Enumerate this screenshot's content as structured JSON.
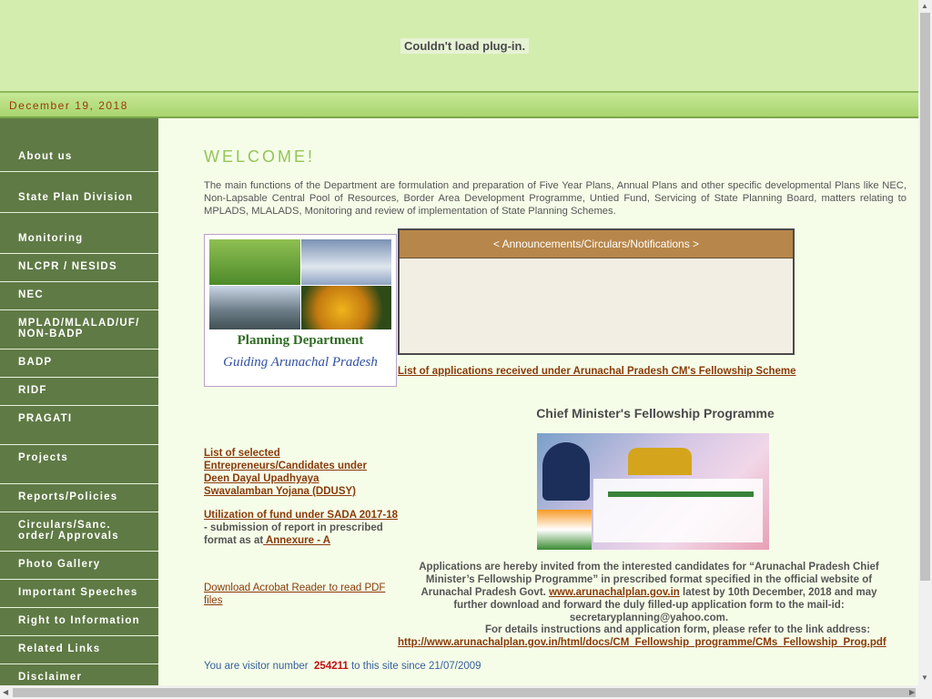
{
  "plugin_message": "Couldn't load plug-in.",
  "date": "December 19, 2018",
  "nav": [
    {
      "label": "About us"
    },
    {
      "label": "State Plan Division"
    },
    {
      "label": "Monitoring"
    },
    {
      "label": "NLCPR / NESIDS"
    },
    {
      "label": "NEC"
    },
    {
      "label": "MPLAD/MLALAD/UF/ NON-BADP"
    },
    {
      "label": "BADP"
    },
    {
      "label": "RIDF"
    },
    {
      "label": "PRAGATI"
    },
    {
      "label": "Projects"
    },
    {
      "label": "Reports/Policies"
    },
    {
      "label": "Circulars/Sanc. order/ Approvals"
    },
    {
      "label": "Photo Gallery"
    },
    {
      "label": "Important Speeches"
    },
    {
      "label": "Right to Information"
    },
    {
      "label": "Related Links"
    },
    {
      "label": "Disclaimer"
    }
  ],
  "welcome": "WELCOME!",
  "intro": "The main functions of the Department are formulation and preparation of Five Year Plans, Annual Plans and other specific developmental Plans like NEC, Non-Lapsable Central Pool of Resources, Border Area Development Programme, Untied Fund, Servicing of State Planning Board, matters relating to MPLADS, MLALADS, Monitoring and review of implementation of State Planning Schemes.",
  "photo": {
    "title": "Planning Department",
    "subtitle": "Guiding Arunachal Pradesh"
  },
  "announcements_header": "< Announcements/Circulars/Notifications >",
  "fellowship_list_link": "List of applications received under Arunachal Pradesh CM's Fellowship Scheme",
  "cm_programme_title": "Chief Minister's Fellowship Programme",
  "ddusy_link": "List of selected Entrepreneurs/Candidates under Deen Dayal Upadhyaya Swavalamban Yojana (DDUSY)",
  "sada": {
    "link": "Utilization of fund under SADA 2017-18",
    "text": " - submission of report in prescribed format as at",
    "annex_link": " Annexure - A"
  },
  "acrobat_link": "Download Acrobat Reader to read PDF files",
  "applications": {
    "part1": "Applications are hereby invited from the interested candidates for “Arunachal Pradesh Chief Minister’s Fellowship Programme” in prescribed format specified in the official website of Arunachal Pradesh Govt.",
    "site_link": "www.arunachalplan.gov.in",
    "part2": "latest by 10th December, 2018 and may further download and forward the duly filled-up application form to the mail-id: secretaryplanning@yahoo.com."
  },
  "details_text": "For details instructions and application form, please refer to the link address:",
  "details_link": "http://www.arunachalplan.gov.in/html/docs/CM_Fellowship_programme/CMs_Fellowship_Prog.pdf",
  "visitor": {
    "prefix": "You are visitor number",
    "count": "254211",
    "suffix": "to this site since 21/07/2009"
  }
}
